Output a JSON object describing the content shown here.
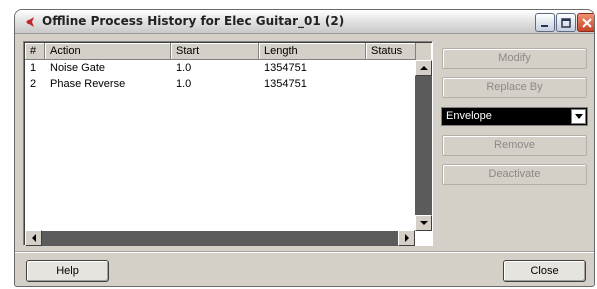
{
  "window": {
    "title": "Offline Process History for Elec Guitar_01 (2)",
    "app_icon": "cubase-logo-icon",
    "controls": [
      "minimize-icon",
      "maximize-icon",
      "close-icon"
    ]
  },
  "list": {
    "columns": [
      "#",
      "Action",
      "Start",
      "Length",
      "Status"
    ],
    "rows": [
      {
        "num": "1",
        "action": "Noise Gate",
        "start": "1.0",
        "length": "1354751",
        "status": ""
      },
      {
        "num": "2",
        "action": "Phase Reverse",
        "start": "1.0",
        "length": "1354751",
        "status": ""
      }
    ]
  },
  "side": {
    "modify": "Modify",
    "replace_by": "Replace By",
    "envelope_value": "Envelope",
    "remove": "Remove",
    "deactivate": "Deactivate"
  },
  "footer": {
    "help": "Help",
    "close": "Close"
  },
  "colors": {
    "window_bg": "#d4d0c8",
    "close_button": "#c8452a",
    "dropdown_bg": "#000000"
  }
}
